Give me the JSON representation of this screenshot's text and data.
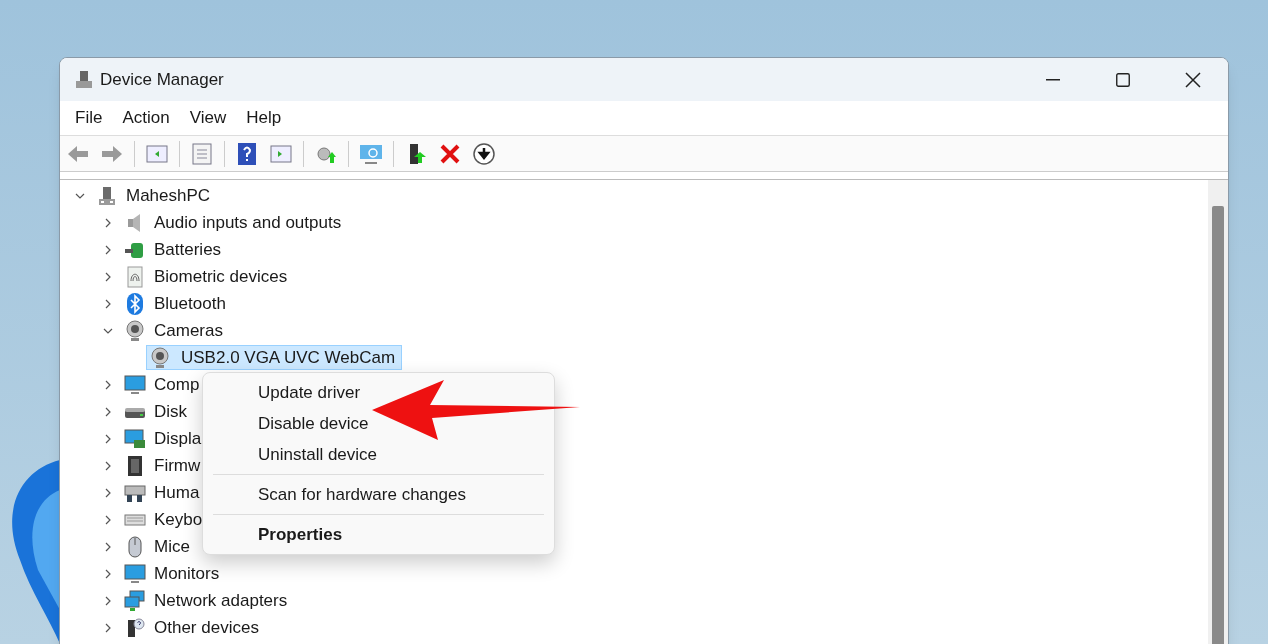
{
  "window": {
    "title": "Device Manager"
  },
  "menu_bar": [
    "File",
    "Action",
    "View",
    "Help"
  ],
  "tree": {
    "label": "MaheshPC",
    "kind": "computer",
    "expanded": true,
    "children": [
      {
        "label": "Audio inputs and outputs",
        "kind": "audio",
        "expanded": false
      },
      {
        "label": "Batteries",
        "kind": "battery",
        "expanded": false
      },
      {
        "label": "Biometric devices",
        "kind": "biometric",
        "expanded": false
      },
      {
        "label": "Bluetooth",
        "kind": "bluetooth",
        "expanded": false
      },
      {
        "label": "Cameras",
        "kind": "camera",
        "expanded": true,
        "children": [
          {
            "label": "USB2.0 VGA UVC WebCam",
            "kind": "camera",
            "selected": true
          }
        ]
      },
      {
        "label": "Comp",
        "kind": "monitor",
        "expanded": false
      },
      {
        "label": "Disk",
        "kind": "disk",
        "expanded": false
      },
      {
        "label": "Displa",
        "kind": "display",
        "expanded": false
      },
      {
        "label": "Firmw",
        "kind": "chip",
        "expanded": false
      },
      {
        "label": "Huma",
        "kind": "hid",
        "expanded": false
      },
      {
        "label": "Keybo",
        "kind": "keyboard",
        "expanded": false
      },
      {
        "label": "Mice",
        "kind": "mouse",
        "expanded": false
      },
      {
        "label": "Monitors",
        "kind": "monitor",
        "expanded": false
      },
      {
        "label": "Network adapters",
        "kind": "network",
        "expanded": false
      },
      {
        "label": "Other devices",
        "kind": "other",
        "expanded": false
      }
    ]
  },
  "context_menu": {
    "groups": [
      [
        {
          "label": "Update driver",
          "default": false
        },
        {
          "label": "Disable device",
          "default": false
        },
        {
          "label": "Uninstall device",
          "default": false
        }
      ],
      [
        {
          "label": "Scan for hardware changes",
          "default": false
        }
      ],
      [
        {
          "label": "Properties",
          "default": true
        }
      ]
    ]
  }
}
